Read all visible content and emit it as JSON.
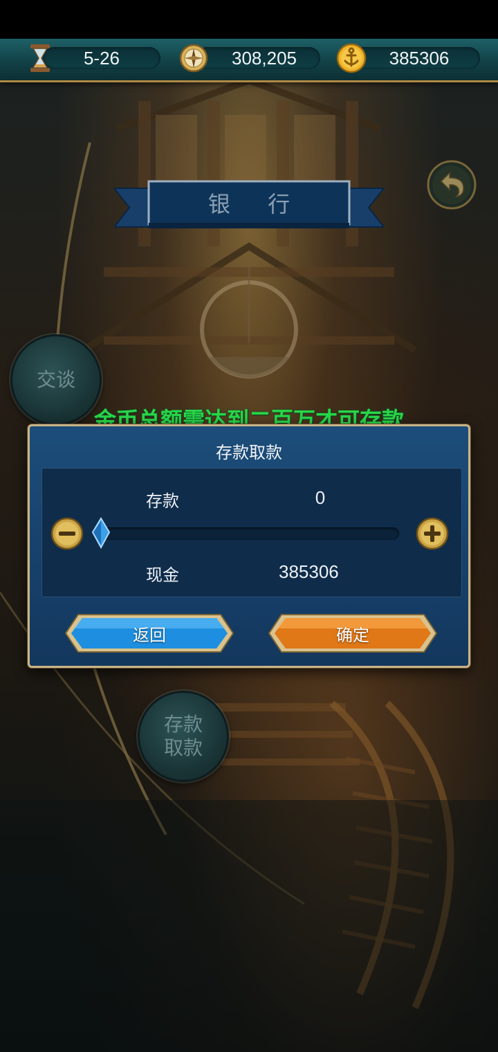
{
  "topbar": {
    "date": "5-26",
    "compass_value": "308,205",
    "gold_value": "385306",
    "icons": [
      "hourglass-icon",
      "compass-icon",
      "anchor-coin-icon"
    ]
  },
  "header": {
    "title": "银 行",
    "back_icon": "back-arrow-icon"
  },
  "side": {
    "talk_label": "交谈",
    "bank_line1": "存款",
    "bank_line2": "取款"
  },
  "notice": "金币总额需达到二百万才可存款",
  "dialog": {
    "title": "存款取款",
    "deposit_label": "存款",
    "deposit_value": "0",
    "cash_label": "现金",
    "cash_value": "385306",
    "slider_fraction": 0,
    "back_button": "返回",
    "confirm_button": "确定"
  },
  "colors": {
    "notice": "#2bd648",
    "dialog_bg": "#184470",
    "frame_gold": "#c9b487",
    "back_button": "#1e8fe0",
    "confirm_button": "#e07818"
  }
}
